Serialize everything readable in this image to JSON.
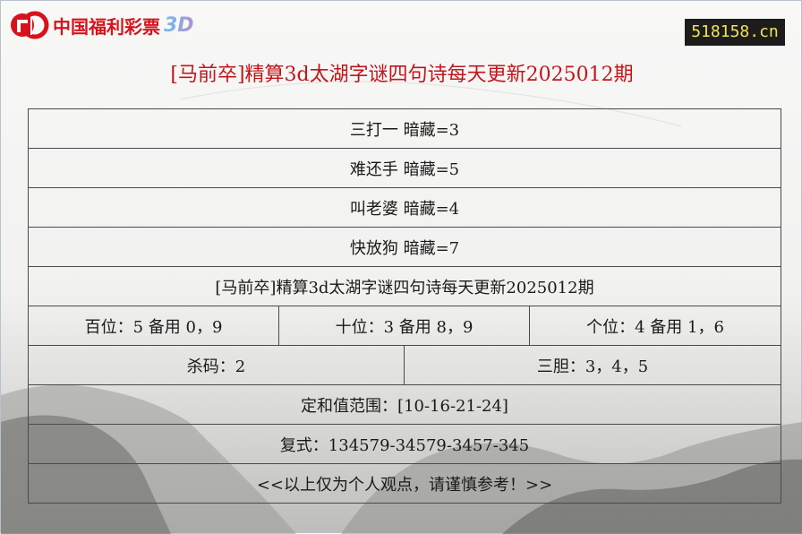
{
  "logo": {
    "text": "中国福利彩票",
    "suffix": "3D",
    "brand_color": "#d6131c"
  },
  "site_badge": {
    "text": "518158.cn",
    "bg_color": "#1c1c1c",
    "text_color": "#f3e25a"
  },
  "page_title": "[马前卒]精算3d太湖字谜四句诗每天更新2025012期",
  "riddles": [
    "三打一 暗藏=3",
    "难还手 暗藏=5",
    "叫老婆 暗藏=4",
    "快放狗 暗藏=7"
  ],
  "issue_title": "[马前卒]精算3d太湖字谜四句诗每天更新2025012期",
  "positions": {
    "hundreds": "百位：5 备用 0，9",
    "tens": "十位：3 备用 8，9",
    "units": "个位：4 备用 1，6"
  },
  "kill_code": "杀码：2",
  "three_gall": "三胆：3，4，5",
  "sum_range": "定和值范围：[10-16-21-24]",
  "compound": "复式：134579-34579-3457-345",
  "disclaimer": "<<以上仅为个人观点，请谨慎参考！>>"
}
